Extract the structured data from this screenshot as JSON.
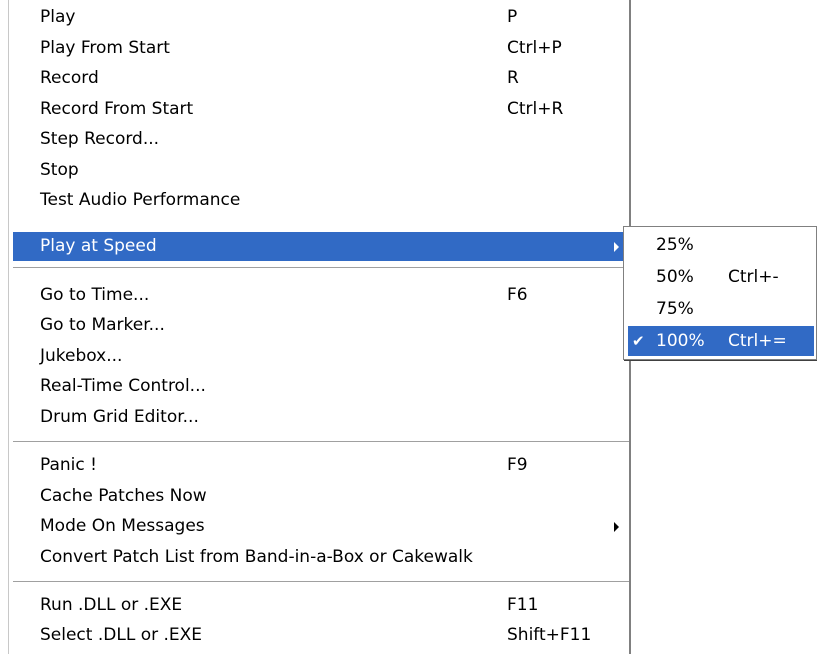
{
  "menu": {
    "items": [
      {
        "label": "Play",
        "shortcut": "P"
      },
      {
        "label": "Play From Start",
        "shortcut": "Ctrl+P"
      },
      {
        "label": "Record",
        "shortcut": "R"
      },
      {
        "label": "Record From Start",
        "shortcut": "Ctrl+R"
      },
      {
        "label": "Step Record...",
        "shortcut": ""
      },
      {
        "label": "Stop",
        "shortcut": ""
      },
      {
        "label": "Test Audio Performance",
        "shortcut": ""
      },
      {
        "label": "Play at Speed",
        "shortcut": "",
        "submenu": true,
        "highlighted": true
      },
      {
        "label": "Go to Time...",
        "shortcut": "F6"
      },
      {
        "label": "Go to Marker...",
        "shortcut": ""
      },
      {
        "label": "Jukebox...",
        "shortcut": ""
      },
      {
        "label": "Real-Time Control...",
        "shortcut": ""
      },
      {
        "label": "Drum Grid Editor...",
        "shortcut": ""
      },
      {
        "label": "Panic !",
        "shortcut": "F9"
      },
      {
        "label": "Cache Patches Now",
        "shortcut": ""
      },
      {
        "label": "Mode On Messages",
        "shortcut": "",
        "submenu": true
      },
      {
        "label": "Convert Patch List from Band-in-a-Box or Cakewalk",
        "shortcut": ""
      },
      {
        "label": "Run .DLL or .EXE",
        "shortcut": "F11"
      },
      {
        "label": "Select .DLL or .EXE",
        "shortcut": "Shift+F11"
      }
    ]
  },
  "speed_submenu": {
    "items": [
      {
        "label": "25%",
        "shortcut": ""
      },
      {
        "label": "50%",
        "shortcut": "Ctrl+-"
      },
      {
        "label": "75%",
        "shortcut": ""
      },
      {
        "label": "100%",
        "shortcut": "Ctrl+=",
        "checked": true,
        "highlighted": true
      }
    ],
    "check_glyph": "✔"
  },
  "colors": {
    "highlight": "#316ac5",
    "highlight_text": "#ffffff",
    "text": "#000000"
  }
}
